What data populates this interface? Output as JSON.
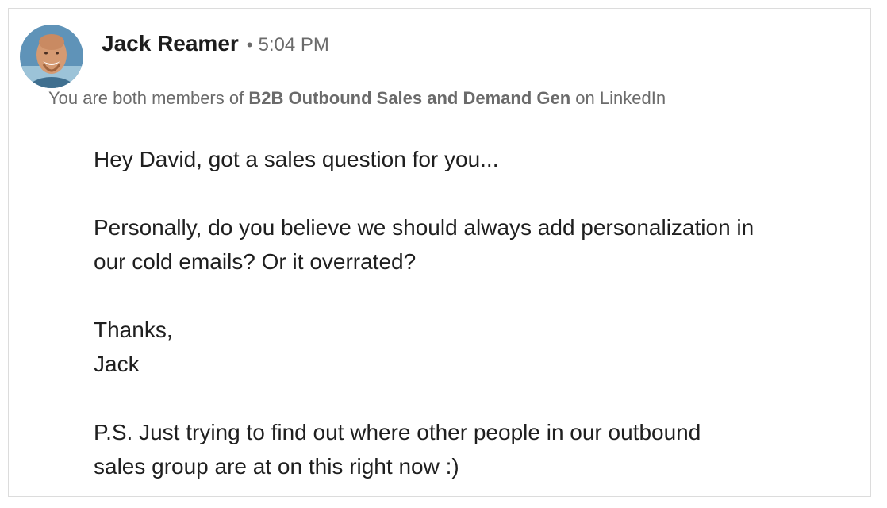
{
  "sender": {
    "name": "Jack Reamer",
    "separator": "•",
    "time": "5:04 PM"
  },
  "context": {
    "prefix": "You are both members of ",
    "group": "B2B Outbound Sales and Demand Gen",
    "suffix": " on LinkedIn"
  },
  "message": {
    "greeting": "Hey David, got a sales question for you...",
    "question_line1": "Personally, do you believe we should always add personalization in",
    "question_line2": "our cold emails? Or it overrated?",
    "signoff": "Thanks,",
    "signature": "Jack",
    "ps_line1": "P.S. Just trying to find out where other people in our outbound",
    "ps_line2": "sales group are at on this right now :)"
  },
  "colors": {
    "text_primary": "#1d1d1d",
    "text_secondary": "#6b6b6b",
    "border": "#dcdcdc"
  }
}
